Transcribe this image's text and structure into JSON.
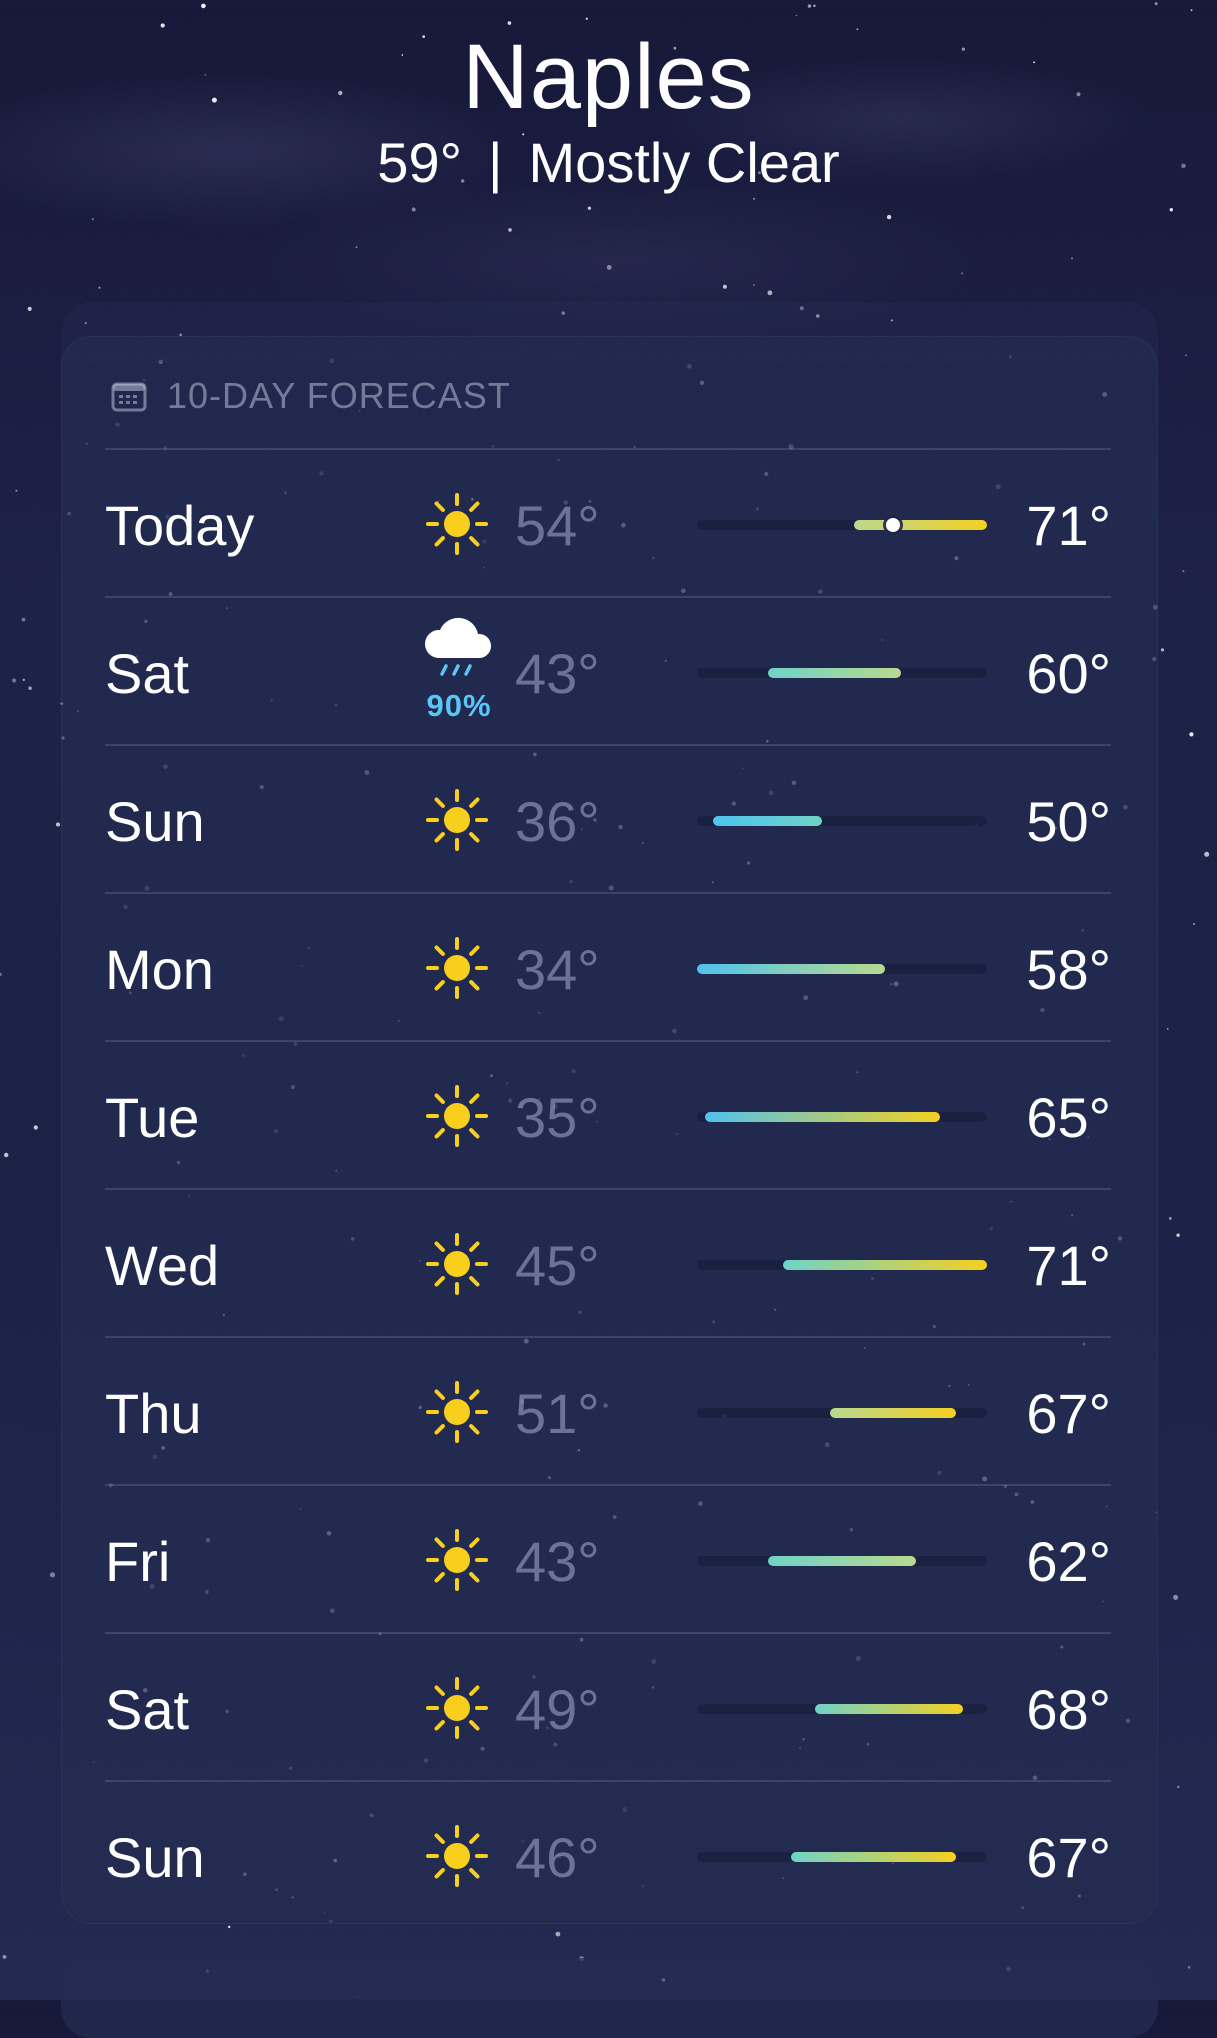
{
  "location": {
    "city": "Naples",
    "current_temp": "59°",
    "separator": "|",
    "condition": "Mostly Clear"
  },
  "forecast": {
    "title": "10-DAY FORECAST",
    "title_icon": "calendar-icon",
    "scale": {
      "min": 34,
      "max": 71
    },
    "current_temperature": 59,
    "colors": {
      "cold": "#4fc3ee",
      "cool": "#6fd3c8",
      "mild": "#b9d88e",
      "warm": "#f5d020"
    },
    "days": [
      {
        "day": "Today",
        "icon": "sun-icon",
        "precip": "",
        "low_label": "54°",
        "high_label": "71°",
        "low": 54,
        "high": 71
      },
      {
        "day": "Sat",
        "icon": "cloud-rain-icon",
        "precip": "90%",
        "low_label": "43°",
        "high_label": "60°",
        "low": 43,
        "high": 60
      },
      {
        "day": "Sun",
        "icon": "sun-icon",
        "precip": "",
        "low_label": "36°",
        "high_label": "50°",
        "low": 36,
        "high": 50
      },
      {
        "day": "Mon",
        "icon": "sun-icon",
        "precip": "",
        "low_label": "34°",
        "high_label": "58°",
        "low": 34,
        "high": 58
      },
      {
        "day": "Tue",
        "icon": "sun-icon",
        "precip": "",
        "low_label": "35°",
        "high_label": "65°",
        "low": 35,
        "high": 65
      },
      {
        "day": "Wed",
        "icon": "sun-icon",
        "precip": "",
        "low_label": "45°",
        "high_label": "71°",
        "low": 45,
        "high": 71
      },
      {
        "day": "Thu",
        "icon": "sun-icon",
        "precip": "",
        "low_label": "51°",
        "high_label": "67°",
        "low": 51,
        "high": 67
      },
      {
        "day": "Fri",
        "icon": "sun-icon",
        "precip": "",
        "low_label": "43°",
        "high_label": "62°",
        "low": 43,
        "high": 62
      },
      {
        "day": "Sat",
        "icon": "sun-icon",
        "precip": "",
        "low_label": "49°",
        "high_label": "68°",
        "low": 49,
        "high": 68
      },
      {
        "day": "Sun",
        "icon": "sun-icon",
        "precip": "",
        "low_label": "46°",
        "high_label": "67°",
        "low": 46,
        "high": 67
      }
    ]
  }
}
